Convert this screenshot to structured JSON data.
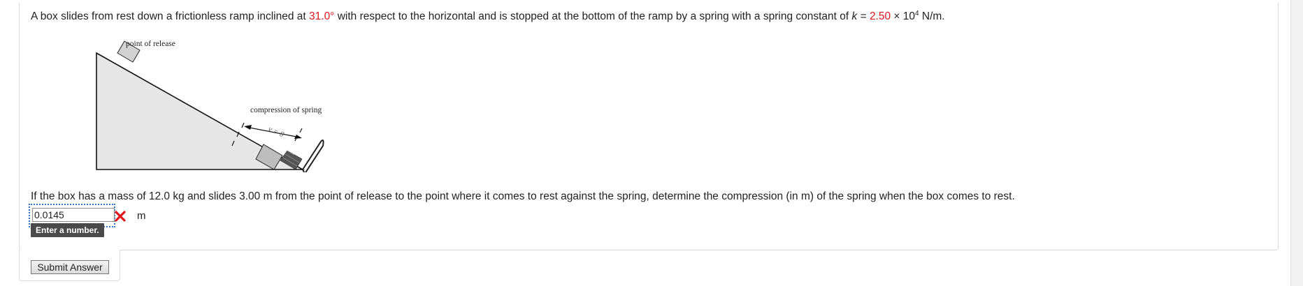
{
  "question": {
    "intro_part1": "A box slides from rest down a frictionless ramp inclined at ",
    "angle": "31.0°",
    "intro_part2": " with respect to the horizontal and is stopped at the bottom of the ramp by a spring with a spring constant of ",
    "k_symbol": "k",
    "equals": " = ",
    "k_value": "2.50",
    "times_ten": " × 10",
    "exponent": "4",
    "k_unit": " N/m.",
    "prompt": "If the box has a mass of 12.0 kg and slides 3.00 m from the point of release to the point where it comes to rest against the spring, determine the compression (in m) of the spring when the box comes to rest."
  },
  "diagram": {
    "release_label": "point of release",
    "compression_label": "compression of spring",
    "velocity_label": "v = 0"
  },
  "answer": {
    "value": "0.0145",
    "unit": "m",
    "tooltip": "Enter a number.",
    "status": "incorrect"
  },
  "submit": {
    "label": "Submit Answer"
  },
  "colors": {
    "highlight": "#e0171c",
    "focus_outline": "#2f76c8",
    "tooltip_bg": "#4a4a4a"
  }
}
